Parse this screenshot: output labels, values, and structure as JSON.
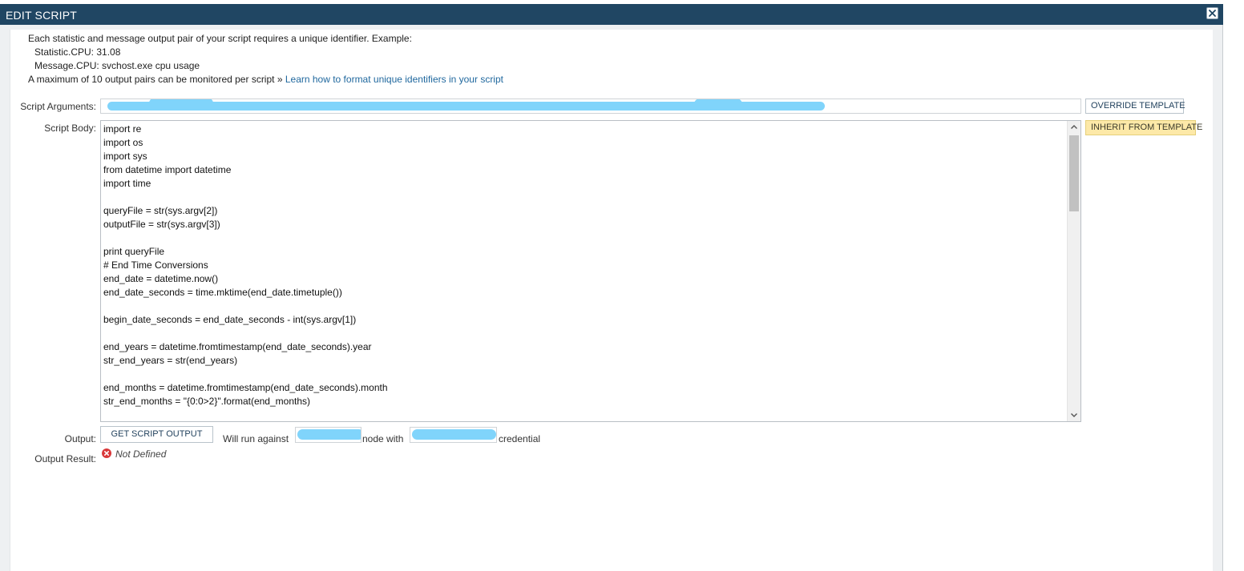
{
  "dialog": {
    "title": "EDIT SCRIPT",
    "close_icon": "close-icon"
  },
  "intro": {
    "line1": "Each statistic and message output pair of your script requires a unique identifier. Example:",
    "line2": "Statistic.CPU: 31.08",
    "line3": "Message.CPU: svchost.exe cpu usage",
    "line4_text": "A maximum of 10 output pairs can be monitored per script »",
    "line4_link": "Learn how to format unique identifiers in your script"
  },
  "script_arguments": {
    "label": "Script Arguments:",
    "value": "",
    "redacted": true
  },
  "buttons": {
    "override_template": "OVERRIDE TEMPLATE",
    "inherit_from_template": "INHERIT FROM TEMPLATE",
    "get_script_output": "GET SCRIPT OUTPUT"
  },
  "script_body": {
    "label": "Script Body:",
    "code": "import re\nimport os\nimport sys\nfrom datetime import datetime\nimport time\n\nqueryFile = str(sys.argv[2])\noutputFile = str(sys.argv[3])\n\nprint queryFile\n# End Time Conversions\nend_date = datetime.now()\nend_date_seconds = time.mktime(end_date.timetuple())\n\nbegin_date_seconds = end_date_seconds - int(sys.argv[1])\n\nend_years = datetime.fromtimestamp(end_date_seconds).year\nstr_end_years = str(end_years)\n\nend_months = datetime.fromtimestamp(end_date_seconds).month\nstr_end_months = \"{0:0>2}\".format(end_months)"
  },
  "output": {
    "label": "Output:",
    "will_run_against": "Will run against",
    "node_with": "node with",
    "credential": "credential",
    "node_value": "",
    "credential_value": ""
  },
  "output_result": {
    "label": "Output Result:",
    "status_icon": "error-circle-icon",
    "value": "Not Defined",
    "status_color": "#d9383a"
  },
  "colors": {
    "titlebar": "#204663",
    "link": "#20689e",
    "active_button": "#fde9a8",
    "redaction": "#80d4fb"
  }
}
